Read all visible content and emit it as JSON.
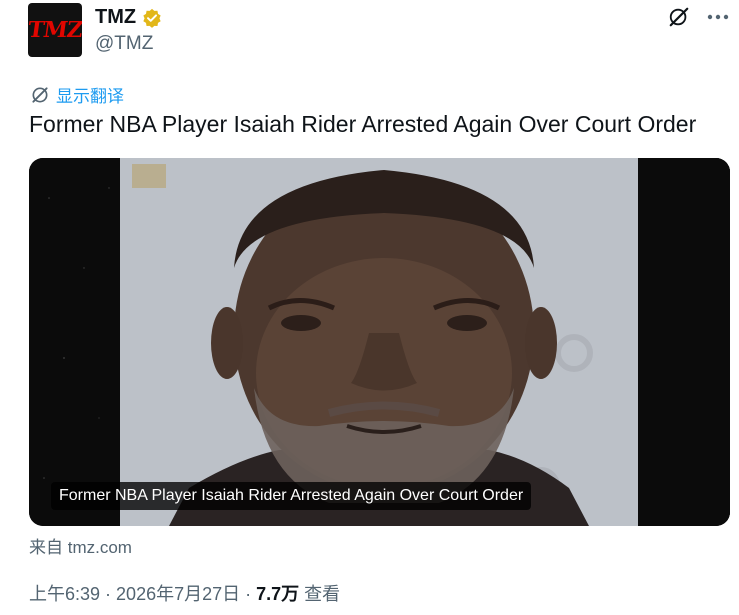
{
  "account": {
    "avatar_text": "TMZ",
    "display_name": "TMZ",
    "handle": "@TMZ",
    "verified": true
  },
  "icons": {
    "grok": "grok-icon",
    "more": "more-icon",
    "translate": "translate-icon",
    "verified": "verified-badge-icon"
  },
  "translate_label": "显示翻译",
  "tweet_text": "Former NBA Player Isaiah Rider Arrested Again Over Court Order",
  "card": {
    "caption": "Former NBA Player Isaiah Rider Arrested Again Over Court Order"
  },
  "source_text": "来自 tmz.com",
  "meta": {
    "time": "上午6:39",
    "sep1": " · ",
    "date": "2026年7月27日",
    "sep2": " · ",
    "views": "7.7万",
    "views_label": " 查看"
  },
  "colors": {
    "accent": "#1d9bf0",
    "secondary_text": "#536471",
    "verified_gold": "#e2b719"
  }
}
